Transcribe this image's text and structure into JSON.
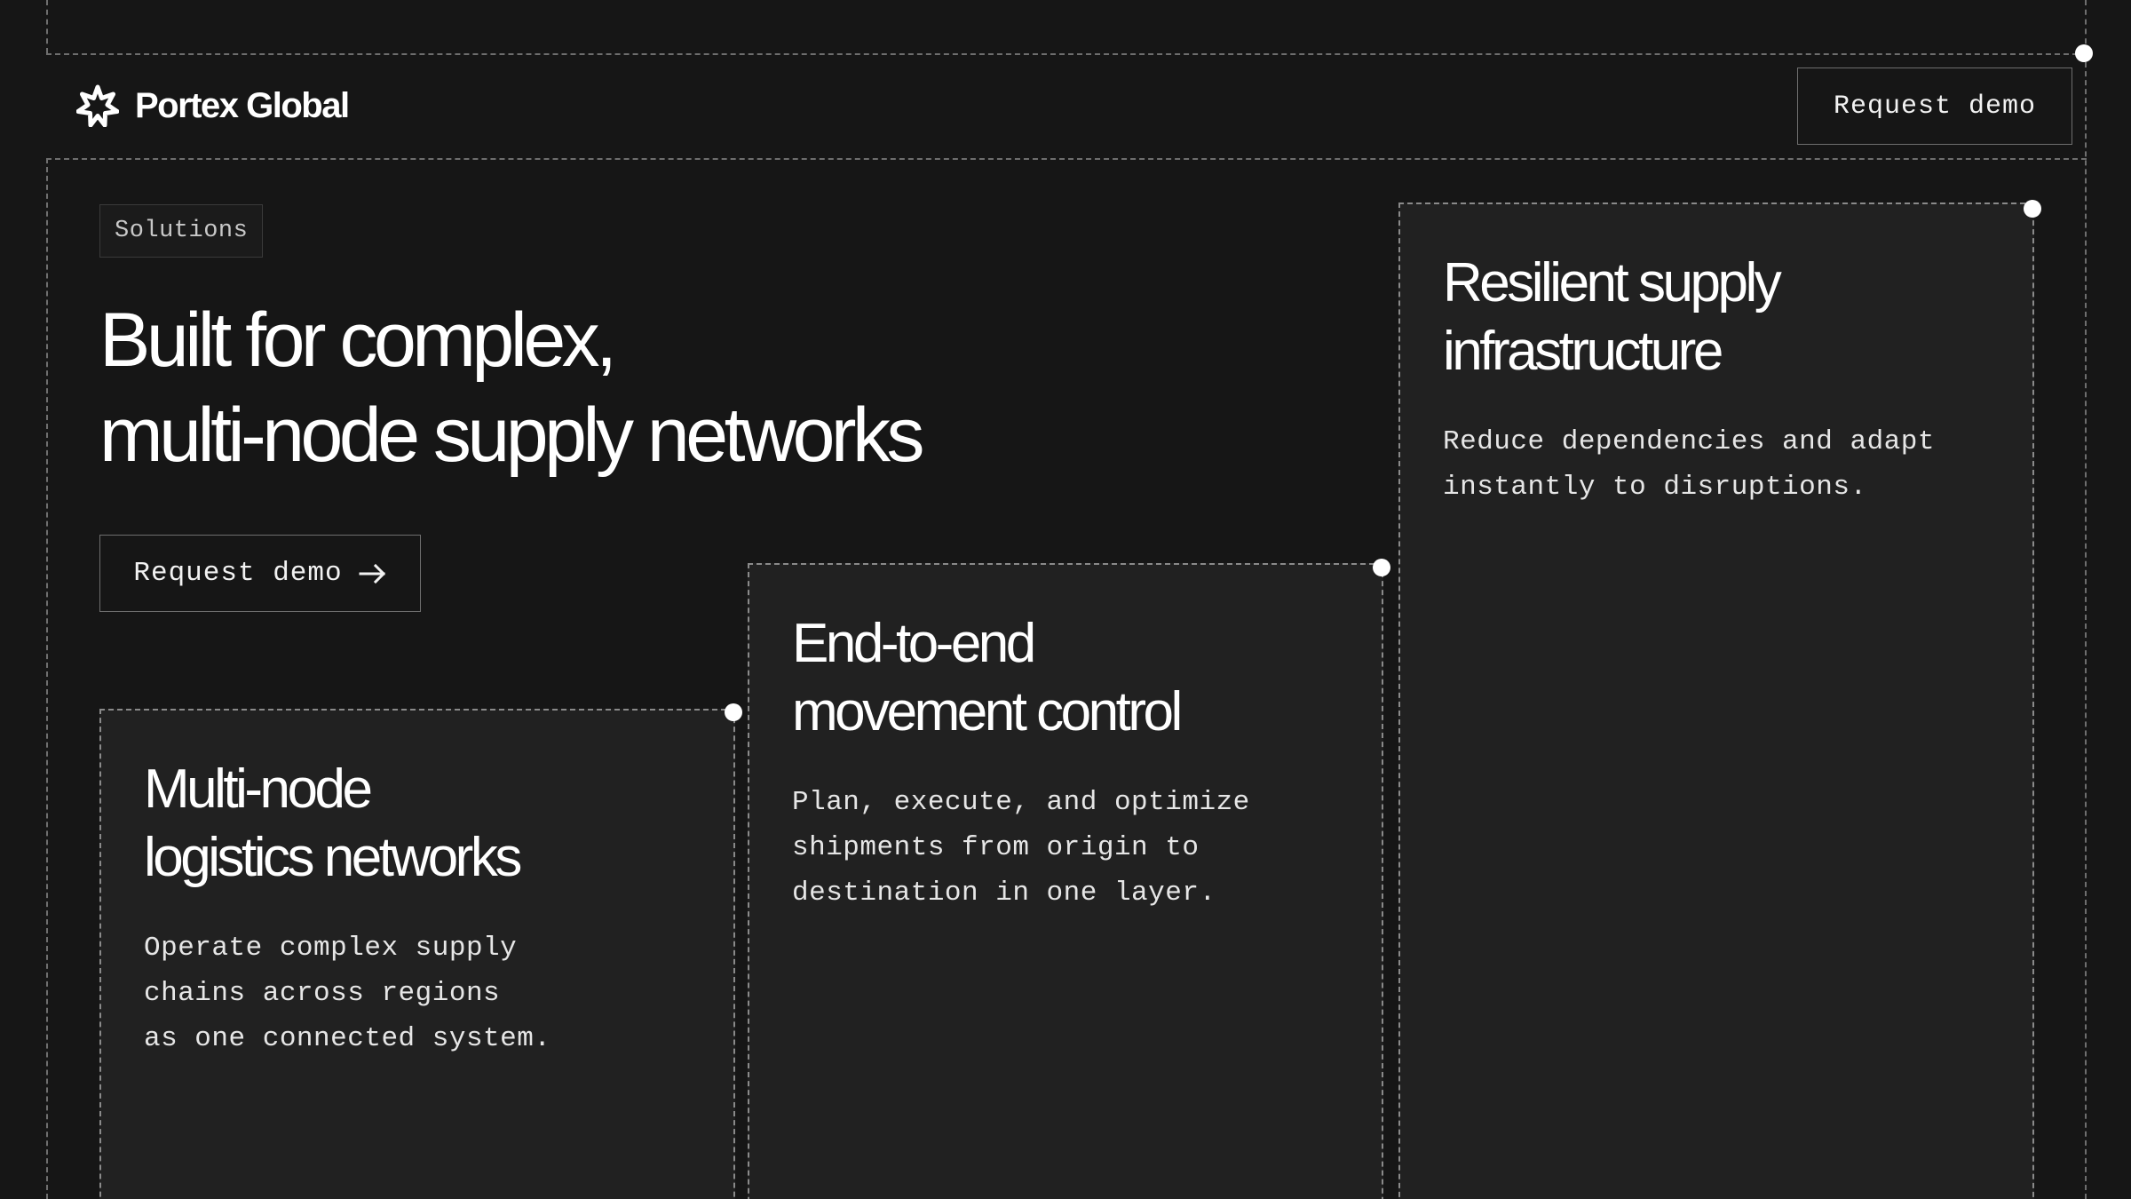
{
  "brand": {
    "logo_icon": "starburst-logo-icon",
    "name": "Portex Global"
  },
  "header": {
    "cta_label": "Request demo"
  },
  "hero": {
    "tag": "Solutions",
    "title_lines": [
      "Built for complex,",
      "multi-node supply networks"
    ],
    "cta_label": "Request demo",
    "cta_icon": "arrow-right-icon"
  },
  "cards": [
    {
      "title_lines": [
        "Multi-node",
        "logistics networks"
      ],
      "body_lines": [
        "Operate complex supply",
        "chains across regions",
        "as one connected system."
      ]
    },
    {
      "title_lines": [
        "End-to-end",
        "movement control"
      ],
      "body_lines": [
        "Plan, execute, and optimize",
        "shipments from origin to",
        "destination in one layer."
      ]
    },
    {
      "title_lines": [
        "Resilient supply",
        "infrastructure"
      ],
      "body_lines": [
        "Reduce dependencies and adapt",
        "instantly to disruptions."
      ]
    }
  ],
  "colors": {
    "background": "#161616",
    "card": "#212121",
    "text": "#ffffff",
    "dashed_line": "#6e6e6e",
    "node_dot": "#ffffff"
  }
}
